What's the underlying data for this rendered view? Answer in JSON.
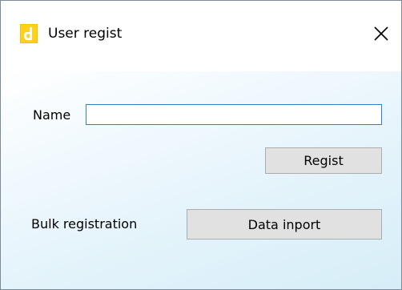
{
  "window": {
    "title": "User regist",
    "icon": "app-icon",
    "close_icon": "close-icon"
  },
  "form": {
    "name_label": "Name",
    "name_value": "",
    "regist_label": "Regist",
    "bulk_label": "Bulk registration",
    "inport_label": "Data inport"
  },
  "colors": {
    "icon_yellow": "#f5c400",
    "input_border": "#2b7fd4",
    "button_face": "#e1e1e1",
    "button_border": "#adadad",
    "client_gradient_end": "#d6eef8"
  }
}
